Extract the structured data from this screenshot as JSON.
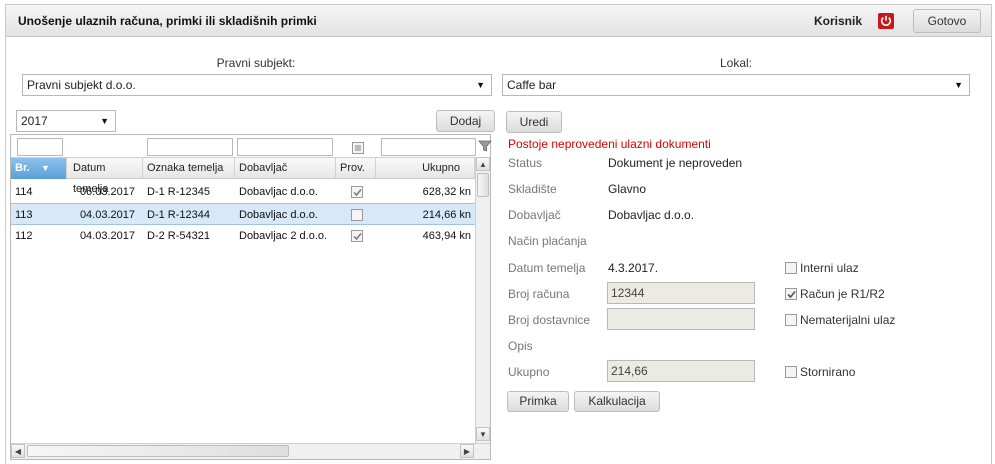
{
  "header": {
    "title": "Unošenje ulaznih računa, primki ili skladišnih primki",
    "user_label": "Korisnik",
    "done_label": "Gotovo",
    "power_icon": "power-icon"
  },
  "subject": {
    "label": "Pravni subjekt:",
    "value": "Pravni subjekt d.o.o."
  },
  "location": {
    "label": "Lokal:",
    "value": "Caffe bar"
  },
  "year": {
    "value": "2017"
  },
  "buttons": {
    "add": "Dodaj",
    "edit": "Uredi",
    "primka": "Primka",
    "kalkulacija": "Kalkulacija"
  },
  "table": {
    "columns": [
      "Br.",
      "Datum temelja",
      "Oznaka temelja",
      "Dobavljač",
      "Prov.",
      "Ukupno"
    ],
    "rows": [
      {
        "br": "114",
        "datum": "06.03.2017",
        "oznaka": "D-1 R-12345",
        "dobavljac": "Dobavljac d.o.o.",
        "prov": true,
        "ukupno": "628,32 kn"
      },
      {
        "br": "113",
        "datum": "04.03.2017",
        "oznaka": "D-1 R-12344",
        "dobavljac": "Dobavljac d.o.o.",
        "prov": false,
        "ukupno": "214,66 kn"
      },
      {
        "br": "112",
        "datum": "04.03.2017",
        "oznaka": "D-2 R-54321",
        "dobavljac": "Dobavljac 2 d.o.o.",
        "prov": true,
        "ukupno": "463,94 kn"
      }
    ],
    "selected_row": 1,
    "filter_icon": "filter-icon"
  },
  "details": {
    "warning": "Postoje neprovedeni ulazni dokumenti",
    "status_label": "Status",
    "status_value": "Dokument je neproveden",
    "skladiste_label": "Skladište",
    "skladiste_value": "Glavno",
    "dobavljac_label": "Dobavljač",
    "dobavljac_value": "Dobavljac d.o.o.",
    "nacin_label": "Način plaćanja",
    "datum_label": "Datum temelja",
    "datum_value": "4.3.2017.",
    "broj_racuna_label": "Broj računa",
    "broj_racuna_value": "12344",
    "broj_dostavnice_label": "Broj dostavnice",
    "broj_dostavnice_value": "",
    "opis_label": "Opis",
    "ukupno_label": "Ukupno",
    "ukupno_value": "214,66"
  },
  "checkboxes": [
    {
      "label": "Interni ulaz",
      "checked": false
    },
    {
      "label": "Račun je R1/R2",
      "checked": true
    },
    {
      "label": "Nematerijalni ulaz",
      "checked": false
    },
    {
      "label": "Stornirano",
      "checked": false
    }
  ],
  "colors": {
    "warning": "#e00000",
    "selected_row": "#d7e8f8",
    "sorted_header": "#5a9fd8",
    "power": "#c51a1a"
  }
}
